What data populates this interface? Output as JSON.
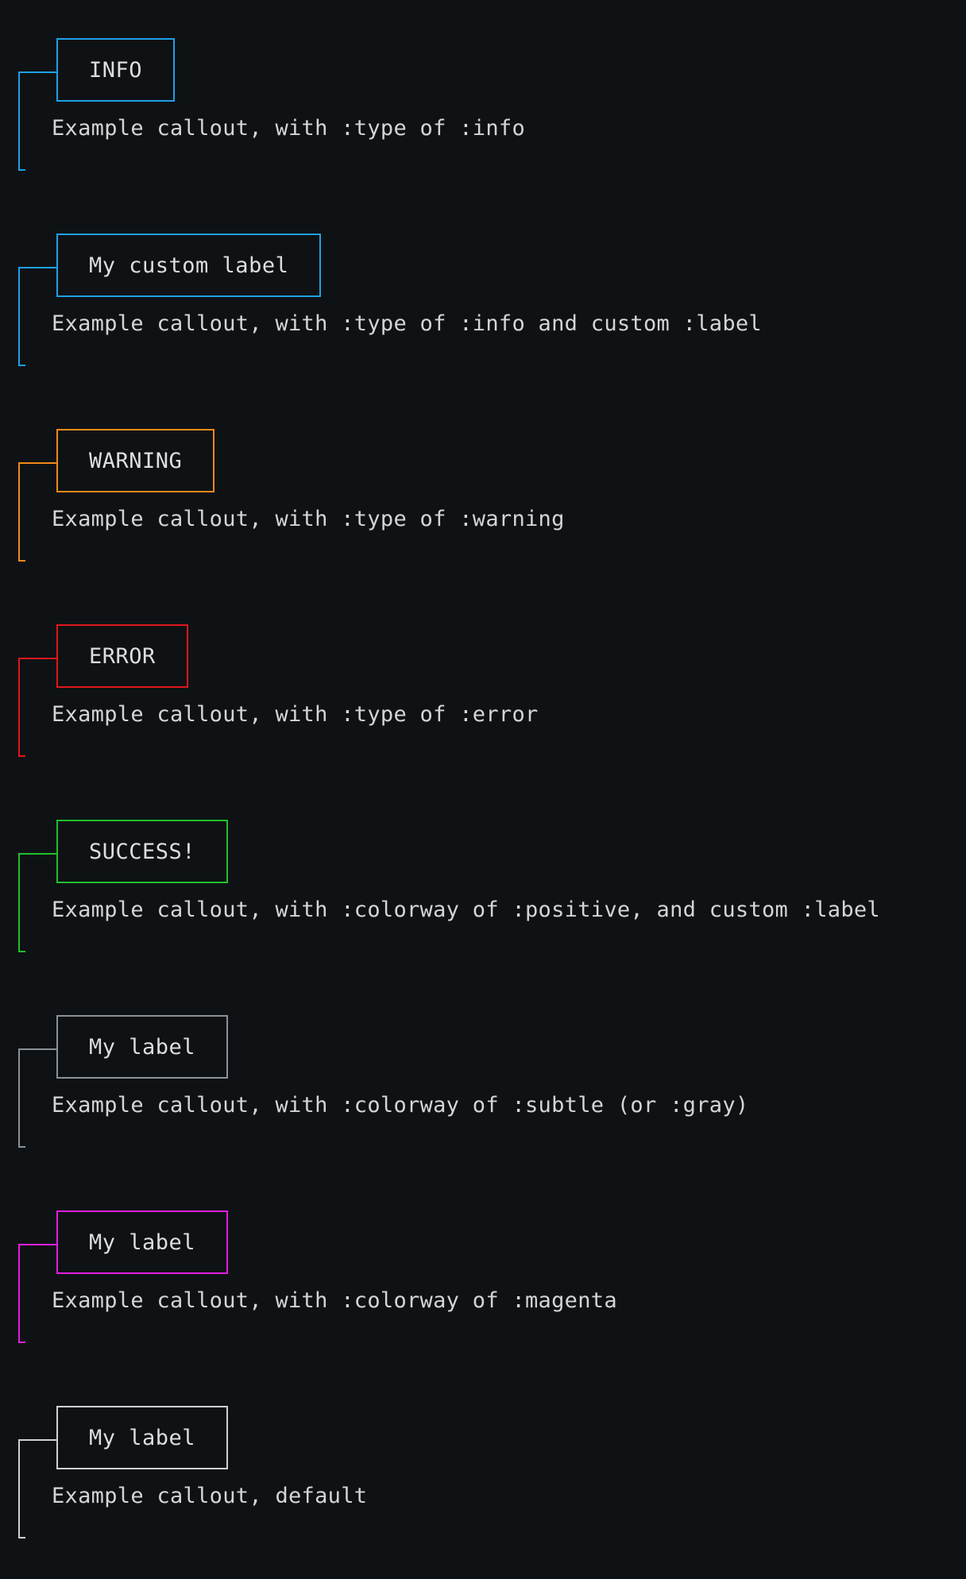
{
  "callouts": [
    {
      "label": "INFO",
      "text": "Example callout, with :type of :info",
      "color": "#1ea0e8"
    },
    {
      "label": "My custom label",
      "text": "Example callout, with :type of :info and custom :label",
      "color": "#1ea0e8"
    },
    {
      "label": "WARNING",
      "text": "Example callout, with :type of :warning",
      "color": "#f08a19"
    },
    {
      "label": "ERROR",
      "text": "Example callout, with :type of :error",
      "color": "#e0161c"
    },
    {
      "label": "SUCCESS!",
      "text": "Example callout, with :colorway of :positive, and custom :label",
      "color": "#1fc02a"
    },
    {
      "label": "My label",
      "text": "Example callout, with :colorway of :subtle (or :gray)",
      "color": "#8c9196"
    },
    {
      "label": "My label",
      "text": "Example callout, with :colorway of :magenta",
      "color": "#e01ee0"
    },
    {
      "label": "My label",
      "text": "Example callout, default",
      "color": "#cfd2d4"
    }
  ]
}
